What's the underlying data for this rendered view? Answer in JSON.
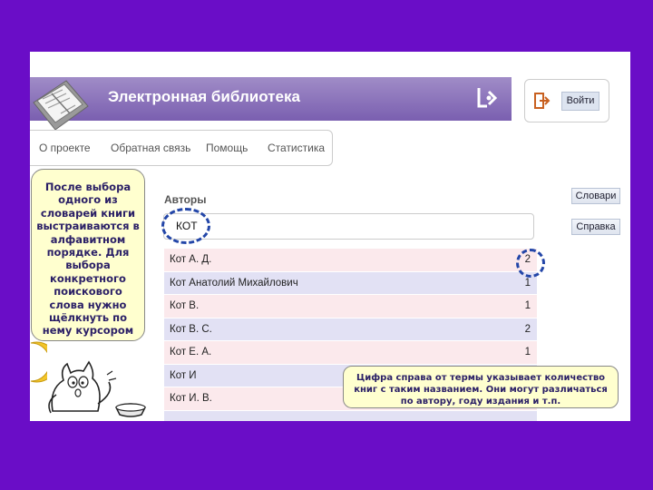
{
  "header": {
    "title": "Электронная библиотека"
  },
  "login": {
    "label": "Войти"
  },
  "nav": {
    "items": [
      "О проекте",
      "Обратная связь",
      "Помощь",
      "Статистика"
    ]
  },
  "side_buttons": {
    "dictionaries": "Словари",
    "help": "Справка"
  },
  "section_label": "Авторы",
  "search": {
    "value": "КОТ"
  },
  "rows": [
    {
      "name": "Кот А. Д.",
      "count": "2"
    },
    {
      "name": "Кот Анатолий Михайлович",
      "count": "1"
    },
    {
      "name": "Кот В.",
      "count": "1"
    },
    {
      "name": "Кот В. С.",
      "count": "2"
    },
    {
      "name": "Кот Е. А.",
      "count": "1"
    },
    {
      "name": "Кот И",
      "count": ""
    },
    {
      "name": "Кот И. В.",
      "count": ""
    },
    {
      "name": "",
      "count": ""
    }
  ],
  "bubble_text": "После выбора одного из словарей книги выстраиваются в алфавитном порядке. Для выбора конкретного поискового слова нужно щёлкнуть по нему курсором",
  "callout_text": "Цифра справа от термы указывает количество книг с таким названием. Они могут различаться по автору, году издания и т.п.",
  "colors": {
    "background": "#6a0dc7",
    "header": "#7a5fb0",
    "row_odd": "#fbe9ec",
    "row_even": "#e2e1f4",
    "highlight": "#2346a8",
    "bubble": "#ffffcf"
  }
}
